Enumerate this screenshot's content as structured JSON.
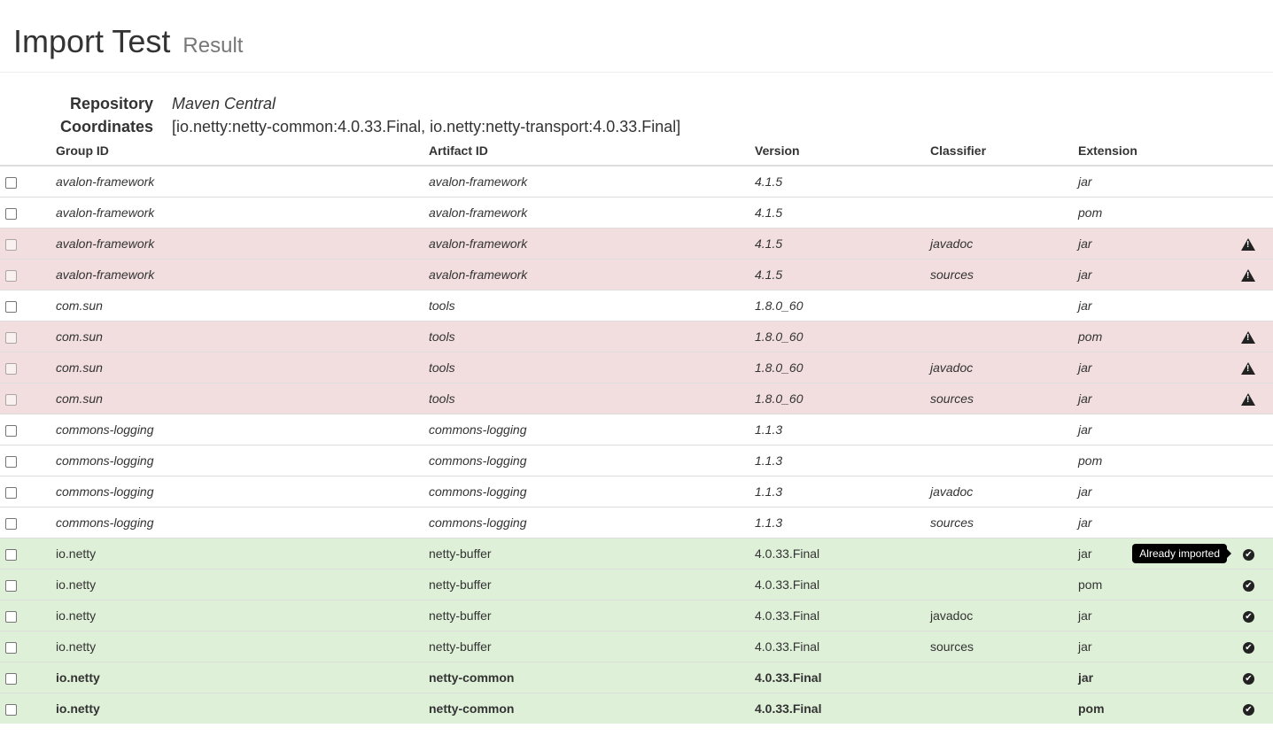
{
  "header": {
    "title": "Import Test",
    "subtitle": "Result"
  },
  "meta": {
    "repository_label": "Repository",
    "repository_value": "Maven Central",
    "coordinates_label": "Coordinates",
    "coordinates_value": "[io.netty:netty-common:4.0.33.Final, io.netty:netty-transport:4.0.33.Final]"
  },
  "table": {
    "columns": [
      "Group ID",
      "Artifact ID",
      "Version",
      "Classifier",
      "Extension"
    ],
    "rows": [
      {
        "group": "avalon-framework",
        "artifact": "avalon-framework",
        "version": "4.1.5",
        "classifier": "",
        "extension": "jar",
        "status": "none"
      },
      {
        "group": "avalon-framework",
        "artifact": "avalon-framework",
        "version": "4.1.5",
        "classifier": "",
        "extension": "pom",
        "status": "none"
      },
      {
        "group": "avalon-framework",
        "artifact": "avalon-framework",
        "version": "4.1.5",
        "classifier": "javadoc",
        "extension": "jar",
        "status": "warning"
      },
      {
        "group": "avalon-framework",
        "artifact": "avalon-framework",
        "version": "4.1.5",
        "classifier": "sources",
        "extension": "jar",
        "status": "warning"
      },
      {
        "group": "com.sun",
        "artifact": "tools",
        "version": "1.8.0_60",
        "classifier": "",
        "extension": "jar",
        "status": "none"
      },
      {
        "group": "com.sun",
        "artifact": "tools",
        "version": "1.8.0_60",
        "classifier": "",
        "extension": "pom",
        "status": "warning"
      },
      {
        "group": "com.sun",
        "artifact": "tools",
        "version": "1.8.0_60",
        "classifier": "javadoc",
        "extension": "jar",
        "status": "warning"
      },
      {
        "group": "com.sun",
        "artifact": "tools",
        "version": "1.8.0_60",
        "classifier": "sources",
        "extension": "jar",
        "status": "warning"
      },
      {
        "group": "commons-logging",
        "artifact": "commons-logging",
        "version": "1.1.3",
        "classifier": "",
        "extension": "jar",
        "status": "none"
      },
      {
        "group": "commons-logging",
        "artifact": "commons-logging",
        "version": "1.1.3",
        "classifier": "",
        "extension": "pom",
        "status": "none"
      },
      {
        "group": "commons-logging",
        "artifact": "commons-logging",
        "version": "1.1.3",
        "classifier": "javadoc",
        "extension": "jar",
        "status": "none"
      },
      {
        "group": "commons-logging",
        "artifact": "commons-logging",
        "version": "1.1.3",
        "classifier": "sources",
        "extension": "jar",
        "status": "none"
      },
      {
        "group": "io.netty",
        "artifact": "netty-buffer",
        "version": "4.0.33.Final",
        "classifier": "",
        "extension": "jar",
        "status": "imported",
        "tooltip": "Already imported"
      },
      {
        "group": "io.netty",
        "artifact": "netty-buffer",
        "version": "4.0.33.Final",
        "classifier": "",
        "extension": "pom",
        "status": "imported"
      },
      {
        "group": "io.netty",
        "artifact": "netty-buffer",
        "version": "4.0.33.Final",
        "classifier": "javadoc",
        "extension": "jar",
        "status": "imported"
      },
      {
        "group": "io.netty",
        "artifact": "netty-buffer",
        "version": "4.0.33.Final",
        "classifier": "sources",
        "extension": "jar",
        "status": "imported"
      },
      {
        "group": "io.netty",
        "artifact": "netty-common",
        "version": "4.0.33.Final",
        "classifier": "",
        "extension": "jar",
        "status": "imported",
        "bold": true
      },
      {
        "group": "io.netty",
        "artifact": "netty-common",
        "version": "4.0.33.Final",
        "classifier": "",
        "extension": "pom",
        "status": "imported",
        "bold": true
      }
    ]
  },
  "icons": {
    "warning": "warning-icon",
    "imported": "check-circle-icon"
  },
  "colors": {
    "danger_row": "#f2dede",
    "success_row": "#dff0d8"
  }
}
